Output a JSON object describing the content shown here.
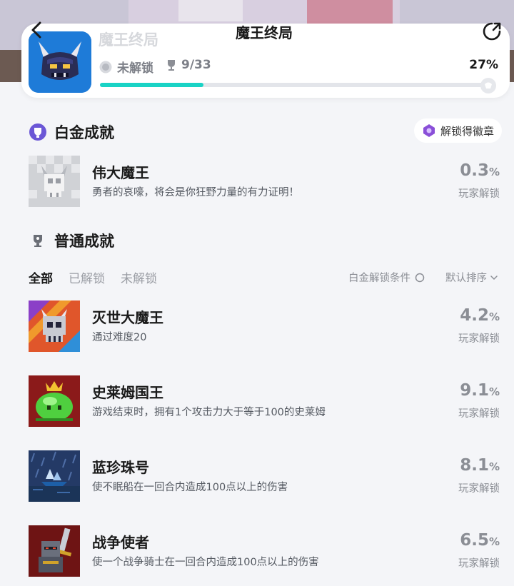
{
  "header": {
    "title": "魔王终局",
    "faded_title": "魔王终局",
    "lock_status": "未解锁",
    "trophy_count": "9/33",
    "percent_label": "27%",
    "progress": 0.27,
    "accent": "#19d3c5"
  },
  "platinum": {
    "section_title": "白金成就",
    "badge_label": "解锁得徽章",
    "item": {
      "name": "伟大魔王",
      "desc": "勇者的哀嚎，将会是你狂野力量的有力证明！",
      "pct": "0.3",
      "pct_unit": "%",
      "unlock_label": "玩家解锁"
    }
  },
  "normal": {
    "section_title": "普通成就",
    "tabs": [
      "全部",
      "已解锁",
      "未解锁"
    ],
    "filter_label": "白金解锁条件",
    "sort_label": "默认排序",
    "items": [
      {
        "name": "灭世大魔王",
        "desc": "通过难度20",
        "pct": "4.2",
        "pct_unit": "%",
        "unlock_label": "玩家解锁"
      },
      {
        "name": "史莱姆国王",
        "desc": "游戏结束时，拥有1个攻击力大于等于100的史莱姆",
        "pct": "9.1",
        "pct_unit": "%",
        "unlock_label": "玩家解锁"
      },
      {
        "name": "蓝珍珠号",
        "desc": "使不眠船在一回合内造成100点以上的伤害",
        "pct": "8.1",
        "pct_unit": "%",
        "unlock_label": "玩家解锁"
      },
      {
        "name": "战争使者",
        "desc": "使一个战争骑士在一回合内造成100点以上的伤害",
        "pct": "6.5",
        "pct_unit": "%",
        "unlock_label": "玩家解锁"
      }
    ]
  }
}
